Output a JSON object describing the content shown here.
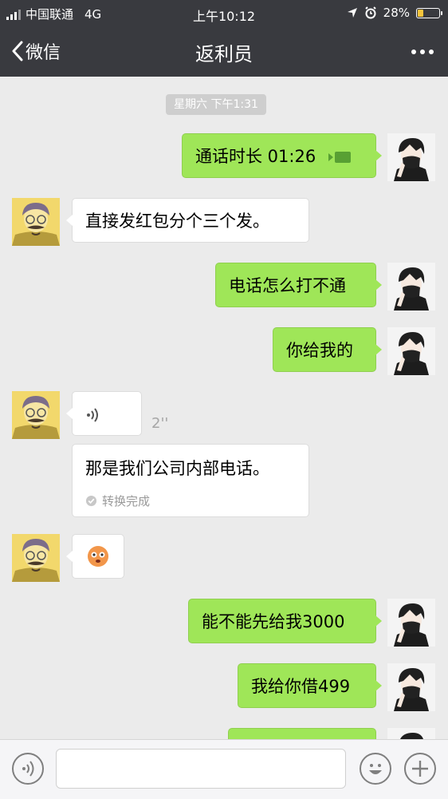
{
  "status_bar": {
    "carrier": "中国联通",
    "network": "4G",
    "time": "上午10:12",
    "battery": "28%"
  },
  "nav": {
    "back_label": "微信",
    "title": "返利员"
  },
  "chat": {
    "timestamp": "星期六 下午1:31",
    "messages": {
      "call_duration": "通话时长 01:26",
      "msg1": "直接发红包分个三个发。",
      "msg2": "电话怎么打不通",
      "msg3": "你给我的",
      "voice_duration": "2''",
      "transcript": "那是我们公司内部电话。",
      "transcript_status": "转换完成",
      "msg4": "能不能先给我3000",
      "msg5": "我给你借499"
    }
  },
  "colors": {
    "header": "#393a3f",
    "outgoing_bubble": "#9fe658",
    "incoming_bubble": "#ffffff",
    "background": "#ebebeb"
  }
}
